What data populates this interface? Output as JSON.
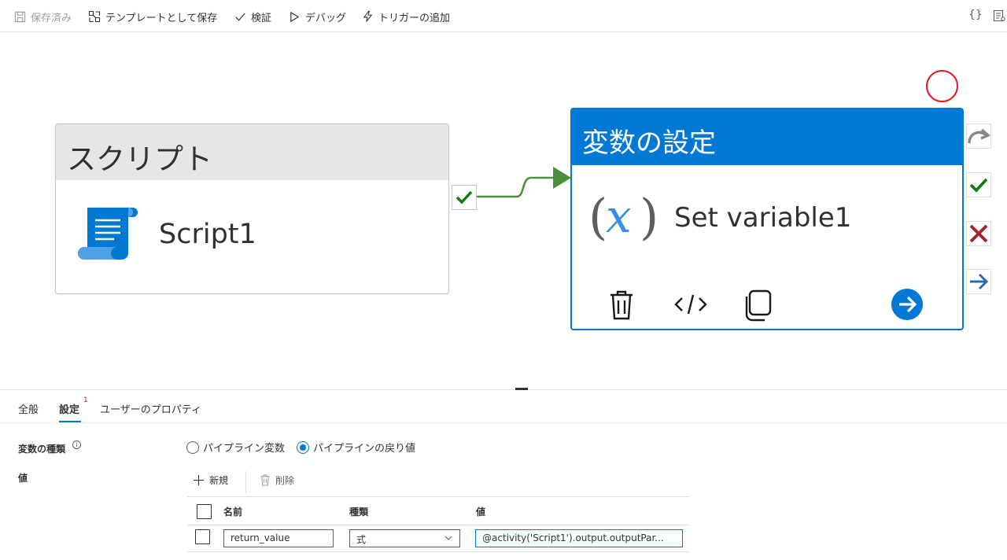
{
  "toolbar": {
    "saved": "保存済み",
    "save_as_template": "テンプレートとして保存",
    "validate": "検証",
    "debug": "デバッグ",
    "add_trigger": "トリガーの追加",
    "code_glyph": "{}"
  },
  "canvas": {
    "script_activity": {
      "type_label": "スクリプト",
      "name": "Script1"
    },
    "setvar_activity": {
      "type_label": "変数の設定",
      "name": "Set variable1",
      "fx_glyph": "x"
    }
  },
  "tabs": [
    {
      "label": "全般"
    },
    {
      "label": "設定",
      "badge": "1"
    },
    {
      "label": "ユーザーのプロパティ"
    }
  ],
  "settings": {
    "variable_type_label": "変数の種類",
    "info_glyph": "i",
    "radio_pipeline_variable": "パイプライン変数",
    "radio_pipeline_return": "パイプラインの戻り値",
    "value_label": "値",
    "new_label": "新規",
    "delete_label": "削除",
    "columns": {
      "name": "名前",
      "type": "種類",
      "value": "値"
    },
    "rows": [
      {
        "name": "return_value",
        "type": "式",
        "value": "@activity('Script1').output.outputPar..."
      }
    ]
  },
  "colors": {
    "accent": "#0078d4",
    "success": "#107c10",
    "failure": "#a4262c",
    "marker": "#e81123"
  }
}
